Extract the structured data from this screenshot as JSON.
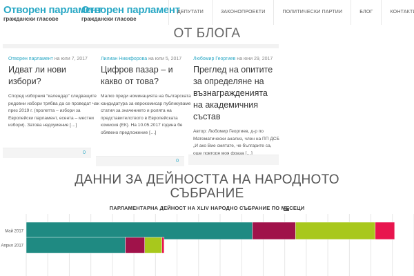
{
  "header": {
    "logos": [
      {
        "title": "Отворен парламент",
        "subtitle": "граждански гласове"
      },
      {
        "title": "Отворен парламент",
        "subtitle": "граждански гласове"
      }
    ],
    "nav": [
      "ДЕПУТАТИ",
      "ЗАКОНОПРОЕКТИ",
      "ПОЛИТИЧЕСКИ ПАРТИИ",
      "БЛОГ",
      "КОНТАКТИ"
    ]
  },
  "blog": {
    "heading": "ОТ БЛОГА",
    "posts": [
      {
        "author": "Отворен парламент",
        "date_prefix": " на ",
        "date": "юли 7, 2017",
        "title": "Идват ли нови избори?",
        "excerpt": "Според изборния “календар” следващите редовни избори трябва да се проведат чак през 2019 г. (пролетта – избори за Европейски парламент, есента – местни избори). Затова недоумение […]",
        "comments": "0"
      },
      {
        "author": "Лилиан Никифорова",
        "date_prefix": " на ",
        "date": "юли 5, 2017",
        "title": "Цифров пазар – и какво от това?",
        "excerpt": "Малко преди номинацията на българската кандидатура за еврокомисар публикуваме статия за значението и ролята на представителството в Европейската комисия (ЕК). На 10.05.2017 година бе обявено предложение […]",
        "comments": "0"
      },
      {
        "author": "Любомир Георгиев",
        "date_prefix": " на ",
        "date": "юни 29, 2017",
        "title": "Преглед на опитите за определяне на възнагражденията на академичния състав",
        "excerpt": "    Автор: Любомир Георгиев, д-р по Математически анализ, член на ПП ДСБ   „И ако Вие смятате, че българите са, още повторя моя фраза […]",
        "comments": "0"
      }
    ]
  },
  "data_section": {
    "heading_line1": "ДАННИ ЗА ДЕЙНОСТТА НА НАРОДНОТО",
    "heading_line2": "СЪБРАНИЕ"
  },
  "chart_data": {
    "type": "bar",
    "orientation": "horizontal",
    "stacked": true,
    "title": "ПАРЛАМЕНТАРНА ДЕЙНОСТ НА XLIV НАРОДНО СЪБРАНИЕ ПО МЕСЕЦИ",
    "categories": [
      "Май 2017",
      "Април 2017"
    ],
    "series": [
      {
        "color": "#1f8a82",
        "values": [
          105,
          46
        ]
      },
      {
        "color": "#a0124a",
        "values": [
          20,
          9
        ]
      },
      {
        "color": "#a8c81c",
        "values": [
          37,
          8
        ]
      },
      {
        "color": "#e8154e",
        "values": [
          9,
          1
        ]
      }
    ],
    "xlim": [
      0,
      180
    ],
    "grid": true
  }
}
